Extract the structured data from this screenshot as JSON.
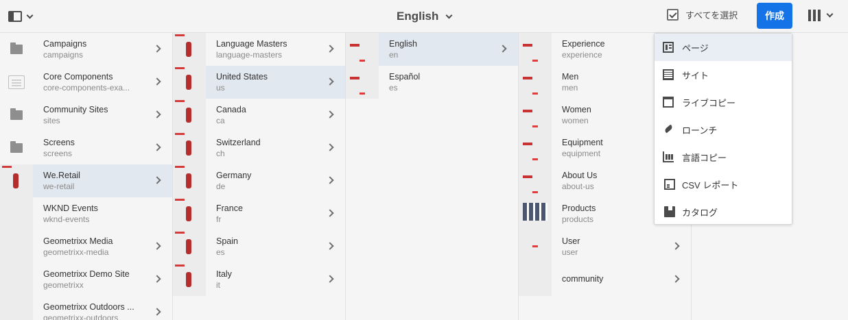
{
  "header": {
    "title": "English",
    "select_all": "すべてを選択",
    "create_label": "作成"
  },
  "columns": [
    {
      "items": [
        {
          "title": "Campaigns",
          "name": "campaigns",
          "thumb": "folder-icon",
          "arrow": true,
          "selected": false
        },
        {
          "title": "Core Components",
          "name": "core-components-exa...",
          "thumb": "component-icon",
          "arrow": true,
          "selected": false
        },
        {
          "title": "Community Sites",
          "name": "sites",
          "thumb": "folder-icon",
          "arrow": true,
          "selected": false
        },
        {
          "title": "Screens",
          "name": "screens",
          "thumb": "folder-icon",
          "arrow": true,
          "selected": false
        },
        {
          "title": "We.Retail",
          "name": "we-retail",
          "thumb": "we-retail-thumb",
          "arrow": true,
          "selected": true
        },
        {
          "title": "WKND Events",
          "name": "wknd-events",
          "thumb": "wknd-thumb",
          "arrow": false,
          "selected": false
        },
        {
          "title": "Geometrixx Media",
          "name": "geometrixx-media",
          "thumb": "geometrixx-media-thumb",
          "arrow": true,
          "selected": false
        },
        {
          "title": "Geometrixx Demo Site",
          "name": "geometrixx",
          "thumb": "geometrixx-thumb",
          "arrow": true,
          "selected": false
        },
        {
          "title": "Geometrixx Outdoors ...",
          "name": "geometrixx-outdoors",
          "thumb": "geometrixx-outdoors-thumb",
          "arrow": true,
          "selected": false
        }
      ]
    },
    {
      "items": [
        {
          "title": "Language Masters",
          "name": "language-masters",
          "thumb": "we-retail-thumb",
          "arrow": true,
          "selected": false
        },
        {
          "title": "United States",
          "name": "us",
          "thumb": "we-retail-thumb",
          "arrow": true,
          "selected": true
        },
        {
          "title": "Canada",
          "name": "ca",
          "thumb": "we-retail-thumb",
          "arrow": true,
          "selected": false
        },
        {
          "title": "Switzerland",
          "name": "ch",
          "thumb": "we-retail-thumb",
          "arrow": true,
          "selected": false
        },
        {
          "title": "Germany",
          "name": "de",
          "thumb": "we-retail-thumb",
          "arrow": true,
          "selected": false
        },
        {
          "title": "France",
          "name": "fr",
          "thumb": "we-retail-thumb",
          "arrow": true,
          "selected": false
        },
        {
          "title": "Spain",
          "name": "es",
          "thumb": "we-retail-thumb",
          "arrow": true,
          "selected": false
        },
        {
          "title": "Italy",
          "name": "it",
          "thumb": "we-retail-thumb",
          "arrow": true,
          "selected": false
        }
      ]
    },
    {
      "items": [
        {
          "title": "English",
          "name": "en",
          "thumb": "page-thumb",
          "arrow": true,
          "selected": true
        },
        {
          "title": "Español",
          "name": "es",
          "thumb": "page-thumb",
          "arrow": false,
          "selected": false
        }
      ]
    },
    {
      "items": [
        {
          "title": "Experience",
          "name": "experience",
          "thumb": "page-thumb",
          "arrow": false,
          "selected": false
        },
        {
          "title": "Men",
          "name": "men",
          "thumb": "page-thumb",
          "arrow": false,
          "selected": false
        },
        {
          "title": "Women",
          "name": "women",
          "thumb": "page-thumb",
          "arrow": false,
          "selected": false
        },
        {
          "title": "Equipment",
          "name": "equipment",
          "thumb": "page-thumb",
          "arrow": false,
          "selected": false
        },
        {
          "title": "About Us",
          "name": "about-us",
          "thumb": "page-thumb",
          "arrow": false,
          "selected": false
        },
        {
          "title": "Products",
          "name": "products",
          "thumb": "products-thumb",
          "arrow": false,
          "selected": false
        },
        {
          "title": "User",
          "name": "user",
          "thumb": "user-thumb",
          "arrow": true,
          "selected": false
        },
        {
          "title": "community",
          "name": "",
          "thumb": "community-thumb",
          "arrow": true,
          "selected": false
        }
      ]
    }
  ],
  "create_menu": {
    "items": [
      {
        "label": "ページ",
        "icon": "page-icon",
        "active": true
      },
      {
        "label": "サイト",
        "icon": "site-icon",
        "active": false
      },
      {
        "label": "ライブコピー",
        "icon": "live-copy-icon",
        "active": false
      },
      {
        "label": "ローンチ",
        "icon": "launch-icon",
        "active": false
      },
      {
        "label": "言語コピー",
        "icon": "language-copy-icon",
        "active": false
      },
      {
        "label": "CSV レポート",
        "icon": "csv-report-icon",
        "active": false
      },
      {
        "label": "カタログ",
        "icon": "catalog-icon",
        "active": false
      }
    ]
  },
  "colors": {
    "accent": "#1473e6",
    "selected_row": "#e2e8f0"
  }
}
